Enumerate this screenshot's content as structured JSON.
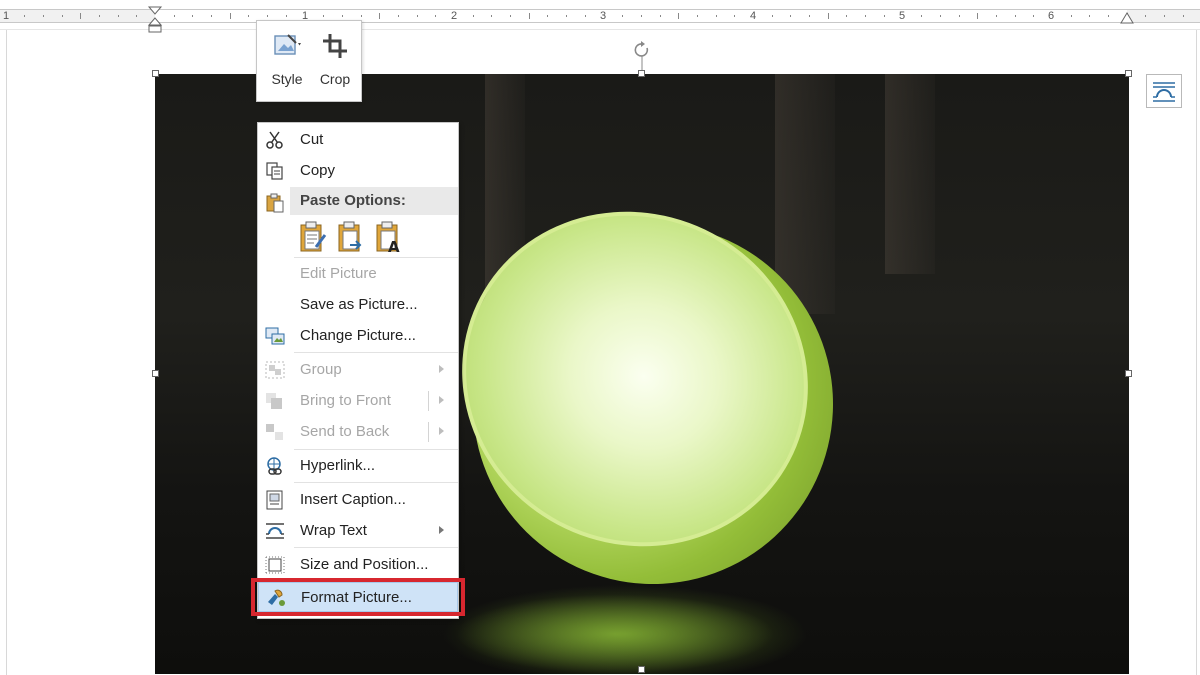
{
  "ruler": {
    "numbers": [
      "1",
      "1",
      "2",
      "3",
      "4",
      "5",
      "6"
    ]
  },
  "mini_toolbar": {
    "style": {
      "label": "Style",
      "icon": "picture-style-icon"
    },
    "crop": {
      "label": "Crop",
      "icon": "crop-icon"
    }
  },
  "context_menu": {
    "cut": {
      "label": "Cut",
      "icon": "scissors-icon",
      "enabled": true
    },
    "copy": {
      "label": "Copy",
      "icon": "copy-icon",
      "enabled": true
    },
    "paste_options": {
      "label": "Paste Options:",
      "icon": "clipboard-icon",
      "options": [
        "paste-keep-formatting-icon",
        "paste-picture-icon",
        "paste-text-only-icon"
      ]
    },
    "edit_picture": {
      "label": "Edit Picture",
      "enabled": false
    },
    "save_as_picture": {
      "label": "Save as Picture...",
      "enabled": true
    },
    "change_picture": {
      "label": "Change Picture...",
      "icon": "change-picture-icon",
      "enabled": true
    },
    "group": {
      "label": "Group",
      "icon": "group-icon",
      "enabled": false,
      "has_submenu": true
    },
    "bring_to_front": {
      "label": "Bring to Front",
      "icon": "bring-front-icon",
      "enabled": false,
      "has_submenu": true
    },
    "send_to_back": {
      "label": "Send to Back",
      "icon": "send-back-icon",
      "enabled": false,
      "has_submenu": true
    },
    "hyperlink": {
      "label": "Hyperlink...",
      "icon": "hyperlink-icon",
      "enabled": true
    },
    "insert_caption": {
      "label": "Insert Caption...",
      "icon": "caption-icon",
      "enabled": true
    },
    "wrap_text": {
      "label": "Wrap Text",
      "icon": "wrap-text-icon",
      "enabled": true,
      "has_submenu": true
    },
    "size_and_position": {
      "label": "Size and Position...",
      "icon": "size-position-icon",
      "enabled": true
    },
    "format_picture": {
      "label": "Format Picture...",
      "icon": "format-picture-icon",
      "enabled": true,
      "highlighted": true
    }
  },
  "colors": {
    "highlight_box": "#d7272f",
    "hover_fill": "#cfe3f7",
    "lamp_green": "#b9dc62"
  }
}
